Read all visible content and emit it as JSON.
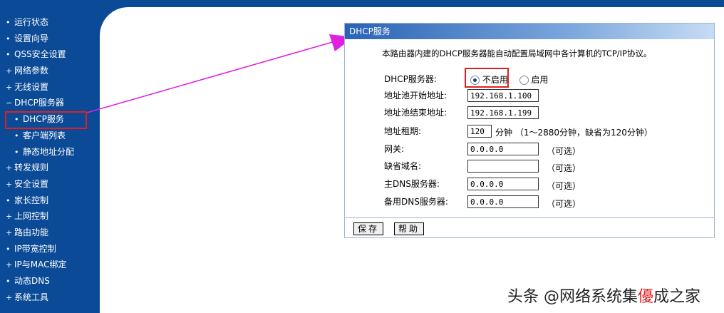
{
  "sidebar": {
    "items": [
      {
        "bullet": "•",
        "label": "运行状态",
        "sub": false
      },
      {
        "bullet": "•",
        "label": "设置向导",
        "sub": false
      },
      {
        "bullet": "•",
        "label": "QSS安全设置",
        "sub": false
      },
      {
        "bullet": "+",
        "label": "网络参数",
        "sub": false
      },
      {
        "bullet": "+",
        "label": "无线设置",
        "sub": false
      },
      {
        "bullet": "−",
        "label": "DHCP服务器",
        "sub": false
      },
      {
        "bullet": "•",
        "label": "DHCP服务",
        "sub": true
      },
      {
        "bullet": "•",
        "label": "客户端列表",
        "sub": true
      },
      {
        "bullet": "•",
        "label": "静态地址分配",
        "sub": true
      },
      {
        "bullet": "+",
        "label": "转发规则",
        "sub": false
      },
      {
        "bullet": "+",
        "label": "安全设置",
        "sub": false
      },
      {
        "bullet": "•",
        "label": "家长控制",
        "sub": false
      },
      {
        "bullet": "+",
        "label": "上网控制",
        "sub": false
      },
      {
        "bullet": "+",
        "label": "路由功能",
        "sub": false
      },
      {
        "bullet": "•",
        "label": "IP带宽控制",
        "sub": false
      },
      {
        "bullet": "+",
        "label": "IP与MAC绑定",
        "sub": false
      },
      {
        "bullet": "•",
        "label": "动态DNS",
        "sub": false
      },
      {
        "bullet": "+",
        "label": "系统工具",
        "sub": false
      }
    ]
  },
  "panel": {
    "title": "DHCP服务",
    "description": "本路由器内建的DHCP服务器能自动配置局域网中各计算机的TCP/IP协议。",
    "dhcp_server": {
      "label": "DHCP服务器:",
      "option_disable": "不启用",
      "option_enable": "启用",
      "selected": "不启用"
    },
    "pool_start": {
      "label": "地址池开始地址:",
      "value": "192.168.1.100"
    },
    "pool_end": {
      "label": "地址池结束地址:",
      "value": "192.168.1.199"
    },
    "lease": {
      "label": "地址租期:",
      "value": "120",
      "unit_hint": "分钟 （1～2880分钟，缺省为120分钟）"
    },
    "gateway": {
      "label": "网关:",
      "value": "0.0.0.0",
      "hint": "（可选）"
    },
    "domain": {
      "label": "缺省域名:",
      "value": "",
      "hint": "（可选）"
    },
    "primary_dns": {
      "label": "主DNS服务器:",
      "value": "0.0.0.0",
      "hint": "（可选）"
    },
    "secondary_dns": {
      "label": "备用DNS服务器:",
      "value": "0.0.0.0",
      "hint": "（可选）"
    },
    "buttons": {
      "save": "保存",
      "help": "帮助"
    }
  },
  "watermark": {
    "prefix": "头条 @网络系统集",
    "mid": "優",
    "suffix": "成之家"
  },
  "colors": {
    "sidebar": "#0b4a96",
    "highlight_box": "#e02020",
    "arrow": "#e020e0"
  }
}
